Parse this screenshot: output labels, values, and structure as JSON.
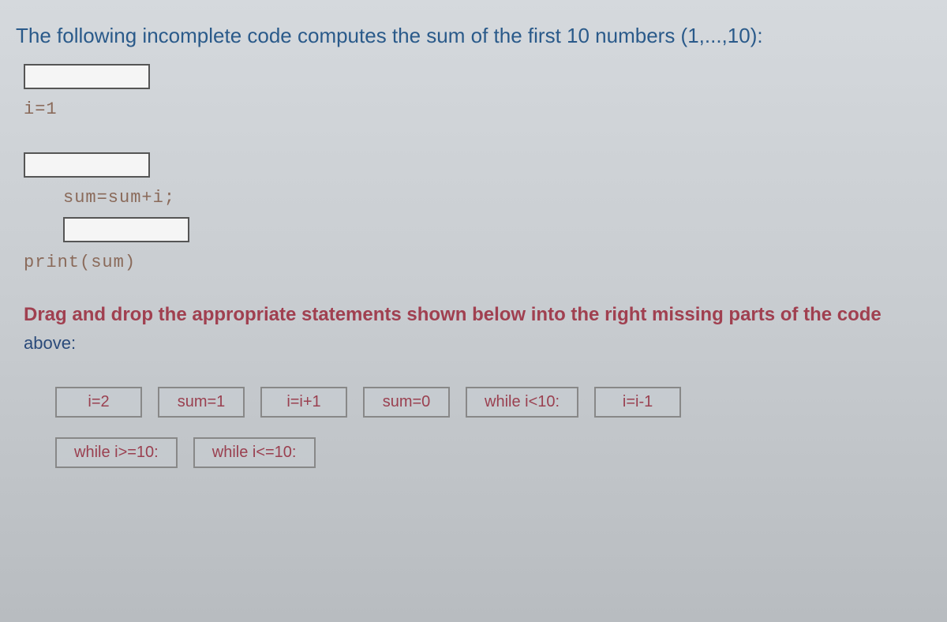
{
  "question": "The following incomplete code computes the sum of the first 10 numbers (1,...,10):",
  "code": {
    "line1": "i=1",
    "line2": "sum=sum+i;",
    "line3": "print(sum)"
  },
  "instruction_main": "Drag and drop the appropriate statements shown below into the right missing parts of the code",
  "instruction_sub": "above:",
  "options": {
    "row1": [
      "i=2",
      "sum=1",
      "i=i+1",
      "sum=0",
      "while i<10:",
      "i=i-1"
    ],
    "row2": [
      "while i>=10:",
      "while i<=10:"
    ]
  }
}
